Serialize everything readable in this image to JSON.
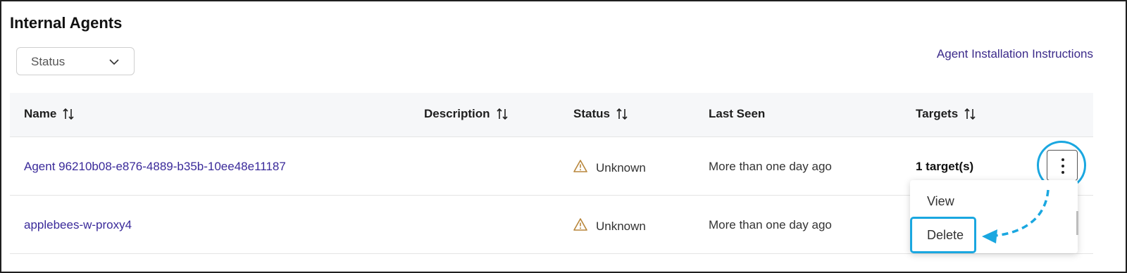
{
  "page": {
    "title": "Internal Agents",
    "install_link": "Agent Installation Instructions"
  },
  "filter": {
    "status_label": "Status"
  },
  "table": {
    "columns": {
      "name": "Name",
      "description": "Description",
      "status": "Status",
      "last_seen": "Last Seen",
      "targets": "Targets"
    },
    "rows": [
      {
        "name": "Agent 96210b08-e876-4889-b35b-10ee48e11187",
        "description": "",
        "status": "Unknown",
        "last_seen": "More than one day ago",
        "targets": "1 target(s)"
      },
      {
        "name": "applebees-w-proxy4",
        "description": "",
        "status": "Unknown",
        "last_seen": "More than one day ago",
        "targets": ""
      }
    ]
  },
  "menu": {
    "view": "View",
    "delete": "Delete"
  },
  "colors": {
    "link": "#3a2a9a",
    "highlight": "#1aa7e0",
    "warning": "#b8863b"
  }
}
